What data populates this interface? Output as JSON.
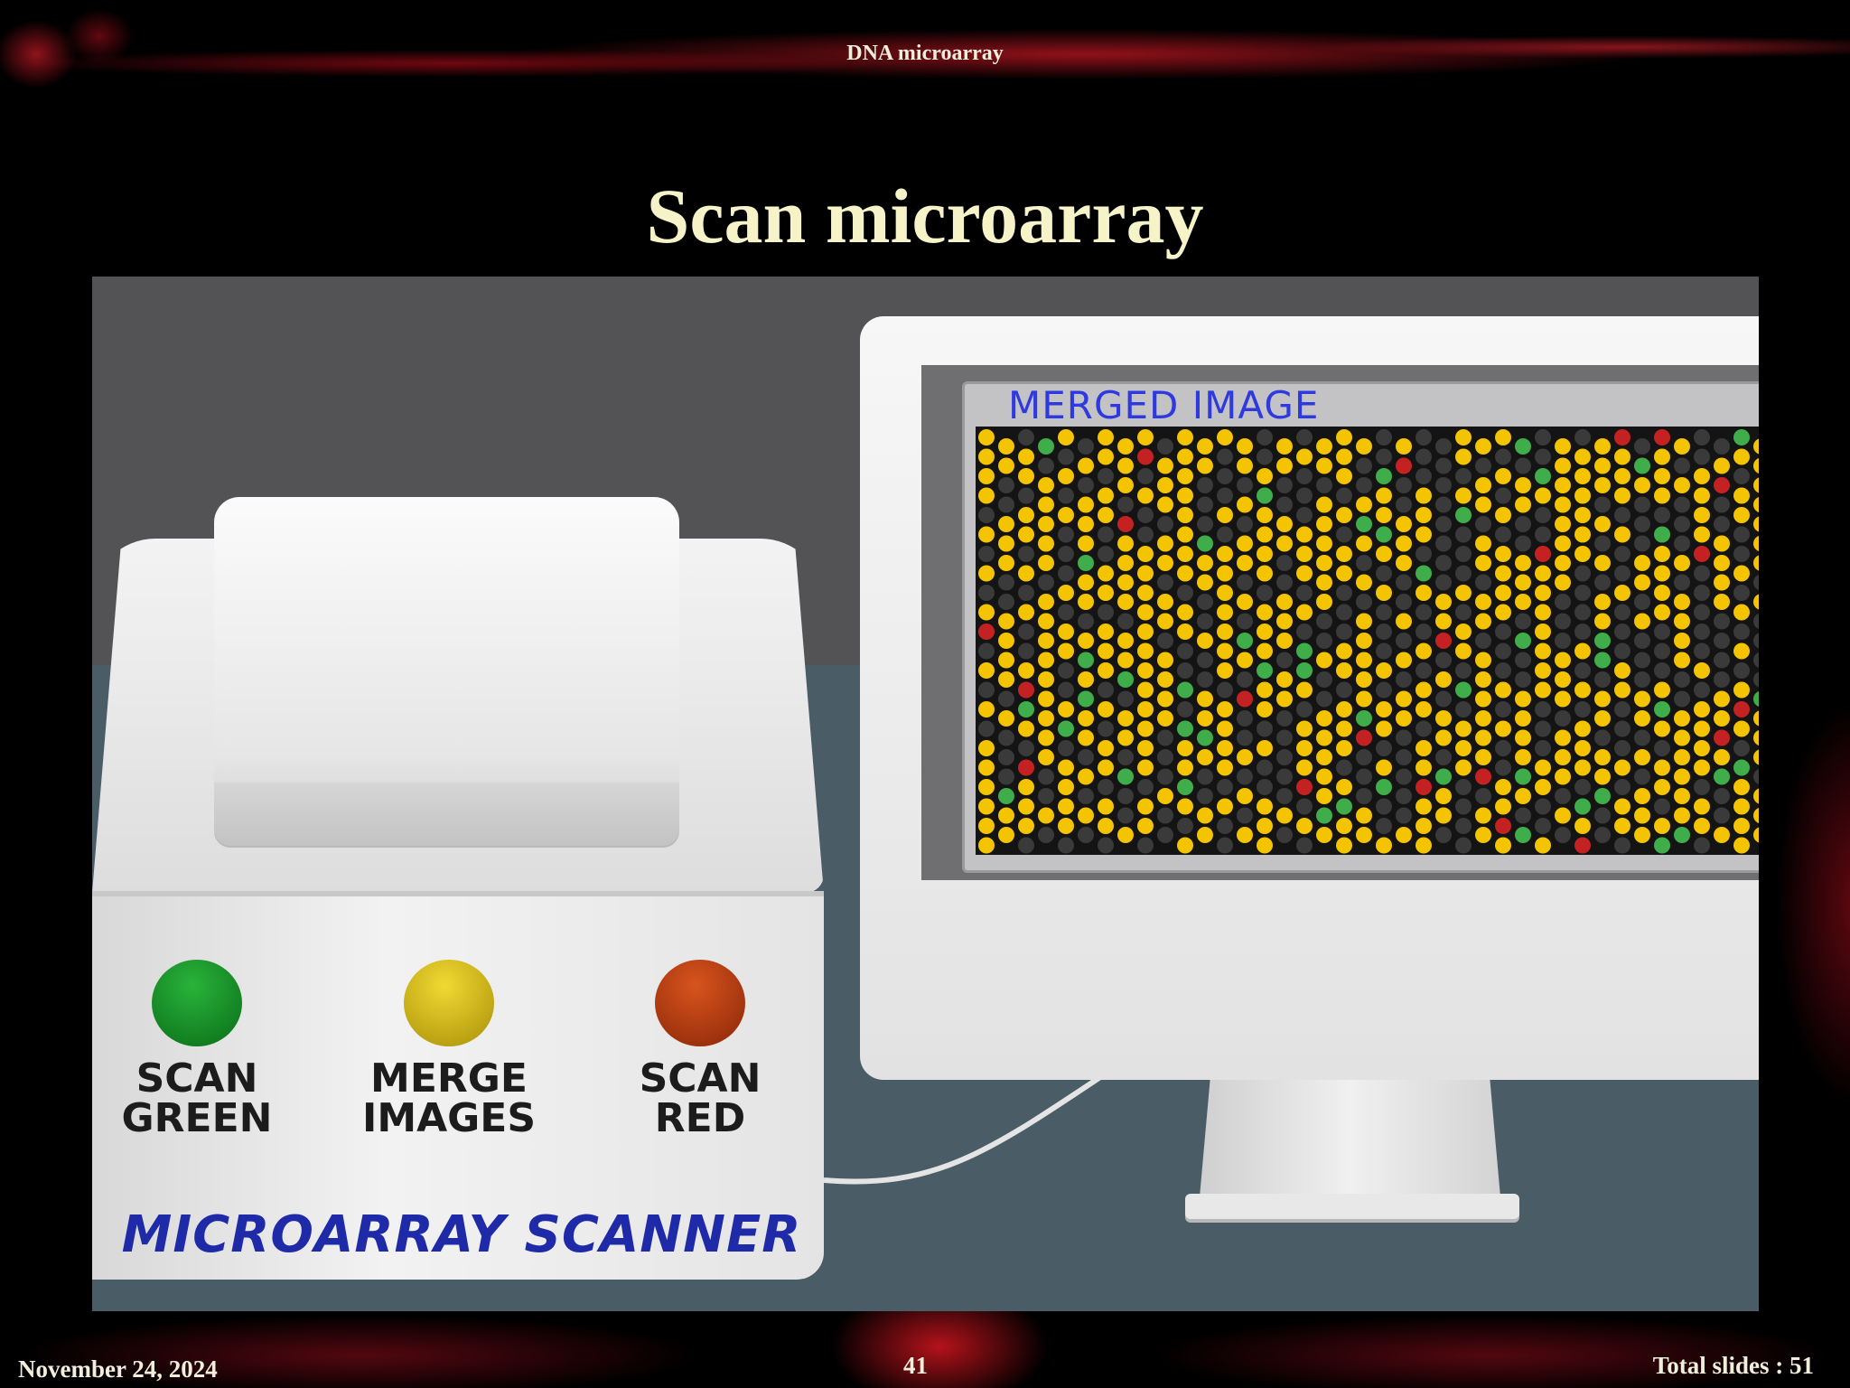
{
  "header": {
    "title": "DNA microarray"
  },
  "slide": {
    "title": "Scan microarray"
  },
  "scanner": {
    "buttons": [
      {
        "line1": "SCAN",
        "line2": "GREEN",
        "color": "#0a8a1e"
      },
      {
        "line1": "MERGE",
        "line2": "IMAGES",
        "color": "#d6bd12"
      },
      {
        "line1": "SCAN",
        "line2": "RED",
        "color": "#b63a10"
      }
    ],
    "name": "MICROARRAY SCANNER"
  },
  "monitor": {
    "screen_title": "MERGED IMAGE",
    "spot_colors": {
      "yellow": "#f5c400",
      "dark": "#3a3a3a",
      "green": "#3fae4a",
      "red": "#c42222"
    }
  },
  "footer": {
    "date": "November 24, 2024",
    "page": "41",
    "total": "Total slides : 51"
  }
}
